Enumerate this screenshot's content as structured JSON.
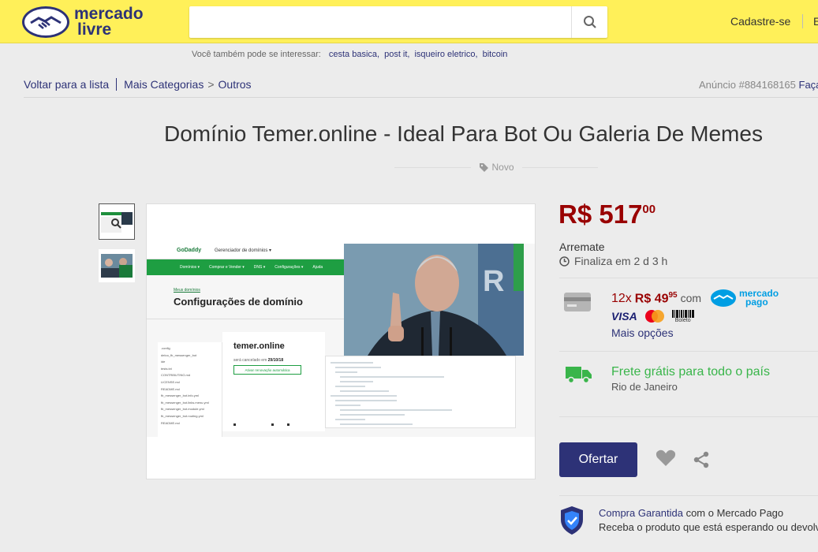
{
  "header": {
    "logo_line1": "mercado",
    "logo_line2": "livre",
    "search_placeholder": "",
    "nav_register": "Cadastre-se",
    "nav_enter": "E"
  },
  "suggestions": {
    "label": "Você também pode se interessar:",
    "items": [
      "cesta basica,",
      "post it,",
      "isqueiro eletrico,",
      "bitcoin"
    ]
  },
  "breadcrumb": {
    "back": "Voltar para a lista",
    "category": "Mais Categorias",
    "gt": ">",
    "sub": "Outros"
  },
  "listing": {
    "id_text": "Anúncio #884168165",
    "share_text": "Faça"
  },
  "product": {
    "title": "Domínio Temer.online - Ideal Para Bot Ou Galeria De Memes",
    "condition": "Novo"
  },
  "image": {
    "godaddy": "GoDaddy",
    "manager": "Gerenciador de domínios ▾",
    "menu": [
      "Domínios ▾",
      "Comprar e Vender ▾",
      "DNS ▾",
      "Configurações ▾",
      "Ajuda"
    ],
    "crumb": "Meus domínios",
    "heading": "Configurações de domínio",
    "domain": "temer.online",
    "cancel_prefix": "será cancelado em",
    "cancel_date": "29/10/18",
    "renew": "Ativar renovação automática",
    "files": [
      ".config",
      "deloo_fb_messenger_bot",
      "ide",
      "tests.txt",
      "CONTRIBUTING.md",
      "LICENSE.md",
      "README.md",
      "fb_messenger_bot.info.yml",
      "fb_messenger_bot.links.menu.yml",
      "fb_messenger_bot.module.yml",
      "fb_messenger_bot.routing.yml",
      "README.md"
    ]
  },
  "pricing": {
    "currency": "R$",
    "amount": "517",
    "cents": "00",
    "type": "Arremate",
    "ends": "Finaliza em 2 d 3 h",
    "installments": "12x",
    "inst_amount": "R$ 49",
    "inst_cents": "95",
    "with": "com",
    "mp_line1": "mercado",
    "mp_line2": "pago",
    "visa": "VISA",
    "boleto": "Boleto",
    "more_options": "Mais opções",
    "shipping": "Frete grátis para todo o país",
    "location": "Rio de Janeiro",
    "offer_button": "Ofertar",
    "guarantee_link": "Compra Garantida",
    "guarantee_rest": "com o Mercado Pago",
    "guarantee_sub": "Receba o produto que está esperando ou devolv"
  },
  "colors": {
    "header_bg": "#fff059",
    "brand_blue": "#2d3277",
    "price_red": "#990000",
    "shipping_green": "#39b54a"
  }
}
